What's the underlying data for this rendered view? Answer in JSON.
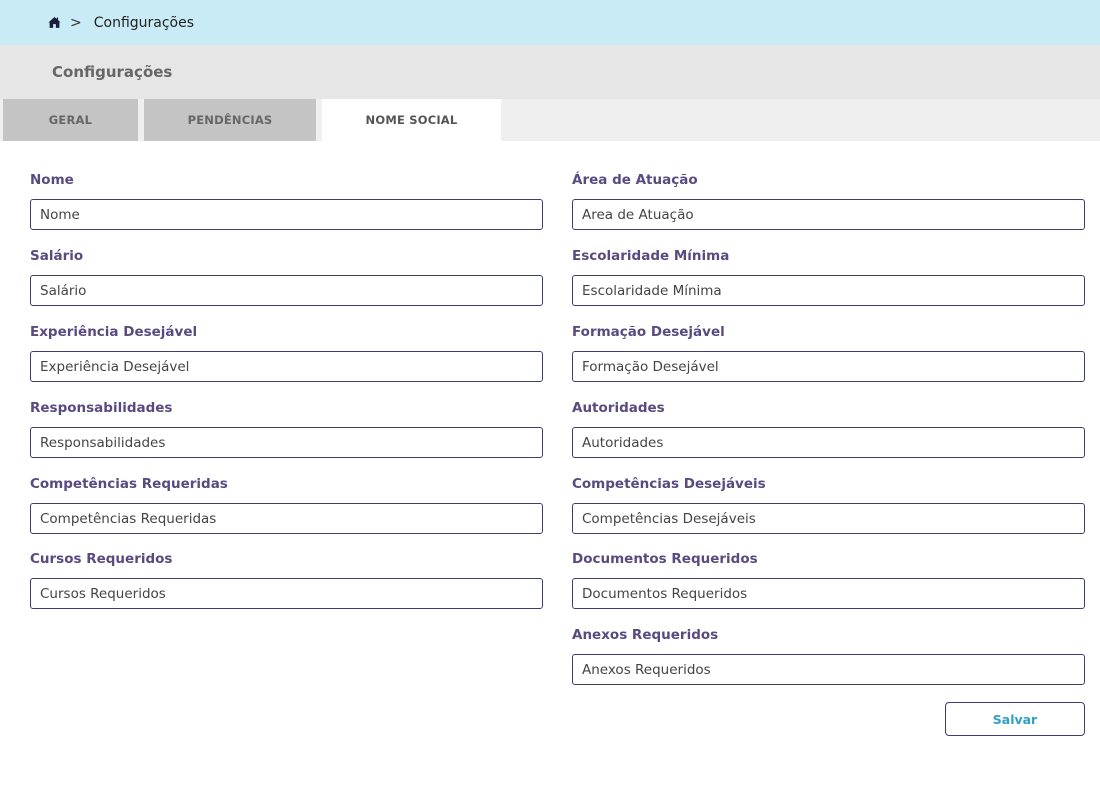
{
  "breadcrumb": {
    "home_icon": "home-icon",
    "separator": ">",
    "current": "Configurações"
  },
  "header": {
    "title": "Configurações"
  },
  "tabs": [
    {
      "label": "GERAL",
      "active": false
    },
    {
      "label": "PENDÊNCIAS",
      "active": false
    },
    {
      "label": "NOME SOCIAL",
      "active": true
    }
  ],
  "form": {
    "left": [
      {
        "label": "Nome",
        "placeholder": "Nome",
        "value": ""
      },
      {
        "label": "Salário",
        "placeholder": "Salário",
        "value": ""
      },
      {
        "label": "Experiência Desejável",
        "placeholder": "Experiência Desejável",
        "value": ""
      },
      {
        "label": "Responsabilidades",
        "placeholder": "Responsabilidades",
        "value": ""
      },
      {
        "label": "Competências Requeridas",
        "placeholder": "Competências Requeridas",
        "value": ""
      },
      {
        "label": "Cursos Requeridos",
        "placeholder": "Cursos Requeridos",
        "value": ""
      }
    ],
    "right": [
      {
        "label": "Área de Atuação",
        "placeholder": "Area de Atuação",
        "value": ""
      },
      {
        "label": "Escolaridade Mínima",
        "placeholder": "Escolaridade Mínima",
        "value": ""
      },
      {
        "label": "Formação Desejável",
        "placeholder": "Formação Desejável",
        "value": ""
      },
      {
        "label": "Autoridades",
        "placeholder": "Autoridades",
        "value": ""
      },
      {
        "label": "Competências Desejáveis",
        "placeholder": "Competências Desejáveis",
        "value": ""
      },
      {
        "label": "Documentos Requeridos",
        "placeholder": "Documentos Requeridos",
        "value": ""
      },
      {
        "label": "Anexos Requeridos",
        "placeholder": "Anexos Requeridos",
        "value": ""
      }
    ],
    "save_label": "Salvar"
  },
  "colors": {
    "breadcrumb_bg": "#c8ebf5",
    "header_bg": "#e6e6e6",
    "label_color": "#5a4a80",
    "save_text": "#2f9fc9"
  }
}
